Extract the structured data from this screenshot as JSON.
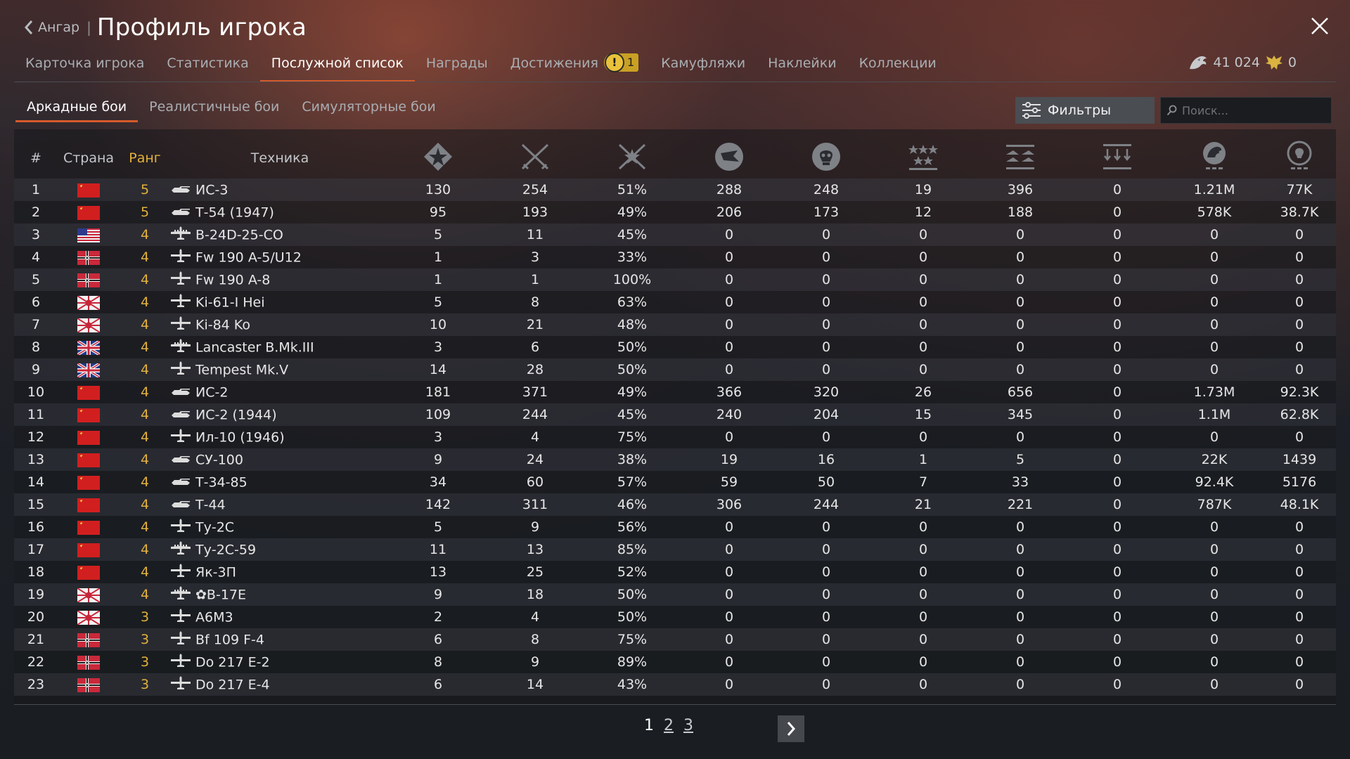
{
  "header": {
    "back_label": "Ангар",
    "separator": "|",
    "title": "Профиль игрока"
  },
  "tabs": [
    {
      "label": "Карточка игрока"
    },
    {
      "label": "Статистика"
    },
    {
      "label": "Послужной список",
      "active": true
    },
    {
      "label": "Награды"
    },
    {
      "label": "Достижения",
      "badge_count": "1"
    },
    {
      "label": "Камуфляжи"
    },
    {
      "label": "Наклейки"
    },
    {
      "label": "Коллекции"
    }
  ],
  "currency": {
    "silver": "41 024",
    "gold": "0"
  },
  "mode_tabs": [
    {
      "label": "Аркадные бои",
      "active": true
    },
    {
      "label": "Реалистичные бои"
    },
    {
      "label": "Симуляторные бои"
    }
  ],
  "filters_label": "Фильтры",
  "search_placeholder": "Поиск...",
  "table": {
    "columns": {
      "num": "#",
      "country": "Страна",
      "rank": "Ранг",
      "vehicle": "Техника"
    },
    "stat_icons": [
      "battles-icon",
      "respawns-icon",
      "win-rate-icon",
      "air-kills-icon",
      "ground-kills-icon",
      "stars-icon",
      "squadrons-icon",
      "fleet-icon",
      "silver-lion-icon",
      "research-points-icon"
    ],
    "rows": [
      {
        "n": "1",
        "flag": "ussr",
        "rank": "5",
        "type": "tank",
        "name": "ИС-3",
        "v": [
          "130",
          "254",
          "51%",
          "288",
          "248",
          "19",
          "396",
          "0",
          "1.21M",
          "77K"
        ]
      },
      {
        "n": "2",
        "flag": "ussr",
        "rank": "5",
        "type": "tank",
        "name": "Т-54 (1947)",
        "v": [
          "95",
          "193",
          "49%",
          "206",
          "173",
          "12",
          "188",
          "0",
          "578K",
          "38.7K"
        ]
      },
      {
        "n": "3",
        "flag": "usa",
        "rank": "4",
        "type": "bomber",
        "name": "B-24D-25-CO",
        "v": [
          "5",
          "11",
          "45%",
          "0",
          "0",
          "0",
          "0",
          "0",
          "0",
          "0"
        ]
      },
      {
        "n": "4",
        "flag": "germany",
        "rank": "4",
        "type": "plane",
        "name": "Fw 190 A-5/U12",
        "v": [
          "1",
          "3",
          "33%",
          "0",
          "0",
          "0",
          "0",
          "0",
          "0",
          "0"
        ]
      },
      {
        "n": "5",
        "flag": "germany",
        "rank": "4",
        "type": "plane",
        "name": "Fw 190 A-8",
        "v": [
          "1",
          "1",
          "100%",
          "0",
          "0",
          "0",
          "0",
          "0",
          "0",
          "0"
        ]
      },
      {
        "n": "6",
        "flag": "japan",
        "rank": "4",
        "type": "plane",
        "name": "Ki-61-I Hei",
        "v": [
          "5",
          "8",
          "63%",
          "0",
          "0",
          "0",
          "0",
          "0",
          "0",
          "0"
        ]
      },
      {
        "n": "7",
        "flag": "japan",
        "rank": "4",
        "type": "plane",
        "name": "Ki-84 Ko",
        "v": [
          "10",
          "21",
          "48%",
          "0",
          "0",
          "0",
          "0",
          "0",
          "0",
          "0"
        ]
      },
      {
        "n": "8",
        "flag": "uk",
        "rank": "4",
        "type": "bomber",
        "name": "Lancaster B.Mk.III",
        "v": [
          "3",
          "6",
          "50%",
          "0",
          "0",
          "0",
          "0",
          "0",
          "0",
          "0"
        ]
      },
      {
        "n": "9",
        "flag": "uk",
        "rank": "4",
        "type": "plane",
        "name": "Tempest Mk.V",
        "v": [
          "14",
          "28",
          "50%",
          "0",
          "0",
          "0",
          "0",
          "0",
          "0",
          "0"
        ]
      },
      {
        "n": "10",
        "flag": "ussr",
        "rank": "4",
        "type": "tank",
        "name": "ИС-2",
        "v": [
          "181",
          "371",
          "49%",
          "366",
          "320",
          "26",
          "656",
          "0",
          "1.73M",
          "92.3K"
        ]
      },
      {
        "n": "11",
        "flag": "ussr",
        "rank": "4",
        "type": "tank",
        "name": "ИС-2 (1944)",
        "v": [
          "109",
          "244",
          "45%",
          "240",
          "204",
          "15",
          "345",
          "0",
          "1.1M",
          "62.8K"
        ]
      },
      {
        "n": "12",
        "flag": "ussr",
        "rank": "4",
        "type": "plane",
        "name": "Ил-10 (1946)",
        "v": [
          "3",
          "4",
          "75%",
          "0",
          "0",
          "0",
          "0",
          "0",
          "0",
          "0"
        ]
      },
      {
        "n": "13",
        "flag": "ussr",
        "rank": "4",
        "type": "tank",
        "name": "СУ-100",
        "v": [
          "9",
          "24",
          "38%",
          "19",
          "16",
          "1",
          "5",
          "0",
          "22K",
          "1439"
        ]
      },
      {
        "n": "14",
        "flag": "ussr",
        "rank": "4",
        "type": "tank",
        "name": "Т-34-85",
        "v": [
          "34",
          "60",
          "57%",
          "59",
          "50",
          "7",
          "33",
          "0",
          "92.4K",
          "5176"
        ]
      },
      {
        "n": "15",
        "flag": "ussr",
        "rank": "4",
        "type": "tank",
        "name": "Т-44",
        "v": [
          "142",
          "311",
          "46%",
          "306",
          "244",
          "21",
          "221",
          "0",
          "787K",
          "48.1K"
        ]
      },
      {
        "n": "16",
        "flag": "ussr",
        "rank": "4",
        "type": "plane",
        "name": "Ту-2С",
        "v": [
          "5",
          "9",
          "56%",
          "0",
          "0",
          "0",
          "0",
          "0",
          "0",
          "0"
        ]
      },
      {
        "n": "17",
        "flag": "ussr",
        "rank": "4",
        "type": "bomber",
        "name": "Ту-2С-59",
        "v": [
          "11",
          "13",
          "85%",
          "0",
          "0",
          "0",
          "0",
          "0",
          "0",
          "0"
        ]
      },
      {
        "n": "18",
        "flag": "ussr",
        "rank": "4",
        "type": "plane",
        "name": "Як-3П",
        "v": [
          "13",
          "25",
          "52%",
          "0",
          "0",
          "0",
          "0",
          "0",
          "0",
          "0"
        ]
      },
      {
        "n": "19",
        "flag": "japan",
        "rank": "4",
        "type": "bomber",
        "name": "B-17E",
        "prefix": "✿",
        "v": [
          "9",
          "18",
          "50%",
          "0",
          "0",
          "0",
          "0",
          "0",
          "0",
          "0"
        ]
      },
      {
        "n": "20",
        "flag": "japan",
        "rank": "3",
        "type": "plane",
        "name": "A6M3",
        "v": [
          "2",
          "4",
          "50%",
          "0",
          "0",
          "0",
          "0",
          "0",
          "0",
          "0"
        ]
      },
      {
        "n": "21",
        "flag": "germany",
        "rank": "3",
        "type": "plane",
        "name": "Bf 109 F-4",
        "v": [
          "6",
          "8",
          "75%",
          "0",
          "0",
          "0",
          "0",
          "0",
          "0",
          "0"
        ]
      },
      {
        "n": "22",
        "flag": "germany",
        "rank": "3",
        "type": "plane",
        "name": "Do 217 E-2",
        "v": [
          "8",
          "9",
          "89%",
          "0",
          "0",
          "0",
          "0",
          "0",
          "0",
          "0"
        ]
      },
      {
        "n": "23",
        "flag": "germany",
        "rank": "3",
        "type": "plane",
        "name": "Do 217 E-4",
        "v": [
          "6",
          "14",
          "43%",
          "0",
          "0",
          "0",
          "0",
          "0",
          "0",
          "0"
        ]
      }
    ]
  },
  "pagination": {
    "pages": [
      "1",
      "2",
      "3"
    ],
    "current": "1"
  },
  "colors": {
    "accent": "#d65a2a",
    "rank": "#e3b13b",
    "badge": "#c9a024"
  }
}
